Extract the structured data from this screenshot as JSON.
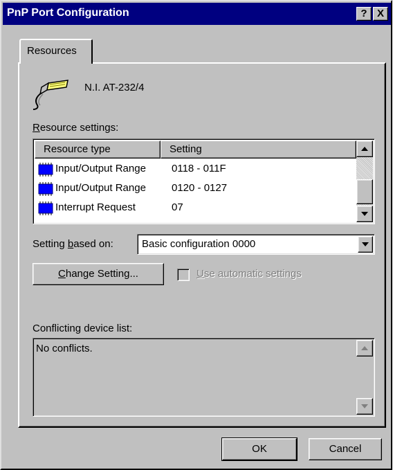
{
  "window": {
    "title": "PnP Port Configuration",
    "help_glyph": "?",
    "close_glyph": "X"
  },
  "tabs": [
    {
      "label": "Resources"
    }
  ],
  "device": {
    "name": "N.I. AT-232/4",
    "icon": "serial-port-connector-icon"
  },
  "resource_settings": {
    "label_mnemonic": "R",
    "label_rest": "esource settings:",
    "columns": [
      "Resource type",
      "Setting"
    ],
    "rows": [
      {
        "type": "Input/Output Range",
        "setting": "0118 - 011F",
        "icon": "io-chip-icon"
      },
      {
        "type": "Input/Output Range",
        "setting": "0120 - 0127",
        "icon": "io-chip-icon"
      },
      {
        "type": "Interrupt Request",
        "setting": "07",
        "icon": "irq-chip-icon"
      }
    ]
  },
  "setting_based_on": {
    "label_pre": "Setting ",
    "label_mnemonic": "b",
    "label_post": "ased on:",
    "value": "Basic configuration 0000"
  },
  "change_setting_button": {
    "label_mnemonic": "C",
    "label_rest": "hange Setting..."
  },
  "auto_settings": {
    "label_mnemonic": "U",
    "label_rest": "se automatic settings",
    "checked": false,
    "enabled": false
  },
  "conflicts": {
    "label": "Conflicting device list:",
    "text": "No conflicts."
  },
  "footer": {
    "ok_label": "OK",
    "cancel_label": "Cancel"
  },
  "colors": {
    "titlebar": "#000080",
    "face": "#c0c0c0",
    "chip": "#0000ff"
  }
}
